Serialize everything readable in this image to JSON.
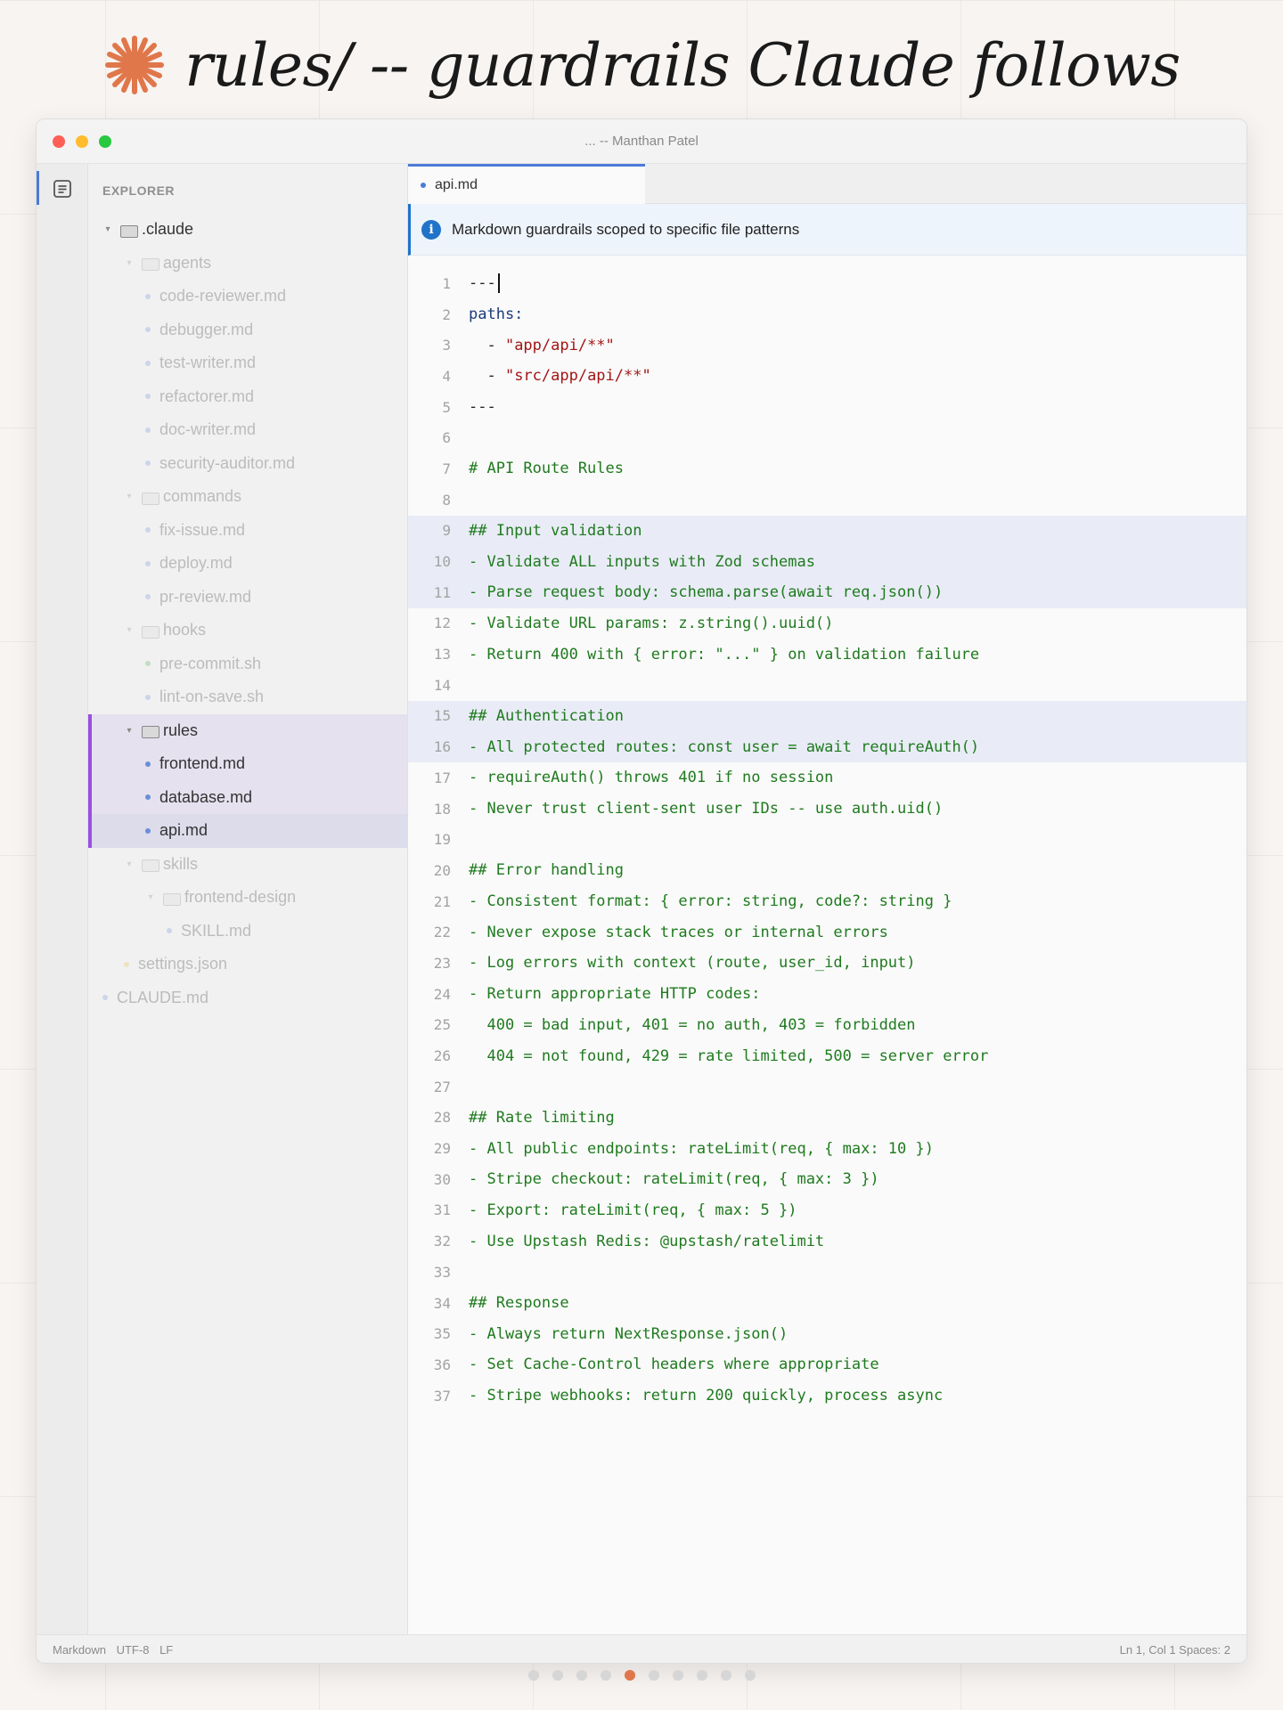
{
  "header": {
    "title": "rules/ -- guardrails Claude follows",
    "logo_icon": "asterisk-burst-icon",
    "logo_color": "#e0774a"
  },
  "window": {
    "title": "... -- Manthan Patel"
  },
  "sidebar": {
    "label": "EXPLORER",
    "tree": [
      {
        "label": ".claude",
        "type": "folder",
        "depth": 0,
        "state": "normal"
      },
      {
        "label": "agents",
        "type": "folder",
        "depth": 1,
        "state": "faded"
      },
      {
        "label": "code-reviewer.md",
        "type": "file",
        "depth": 2,
        "state": "faded"
      },
      {
        "label": "debugger.md",
        "type": "file",
        "depth": 2,
        "state": "faded"
      },
      {
        "label": "test-writer.md",
        "type": "file",
        "depth": 2,
        "state": "faded"
      },
      {
        "label": "refactorer.md",
        "type": "file",
        "depth": 2,
        "state": "faded"
      },
      {
        "label": "doc-writer.md",
        "type": "file",
        "depth": 2,
        "state": "faded"
      },
      {
        "label": "security-auditor.md",
        "type": "file",
        "depth": 2,
        "state": "faded"
      },
      {
        "label": "commands",
        "type": "folder",
        "depth": 1,
        "state": "faded"
      },
      {
        "label": "fix-issue.md",
        "type": "file",
        "depth": 2,
        "state": "faded"
      },
      {
        "label": "deploy.md",
        "type": "file",
        "depth": 2,
        "state": "faded"
      },
      {
        "label": "pr-review.md",
        "type": "file",
        "depth": 2,
        "state": "faded"
      },
      {
        "label": "hooks",
        "type": "folder",
        "depth": 1,
        "state": "faded"
      },
      {
        "label": "pre-commit.sh",
        "type": "file",
        "depth": 2,
        "state": "faded",
        "dot": "#4caf50"
      },
      {
        "label": "lint-on-save.sh",
        "type": "file",
        "depth": 2,
        "state": "faded"
      },
      {
        "label": "rules",
        "type": "folder",
        "depth": 1,
        "state": "rules"
      },
      {
        "label": "frontend.md",
        "type": "file",
        "depth": 2,
        "state": "rules"
      },
      {
        "label": "database.md",
        "type": "file",
        "depth": 2,
        "state": "rules"
      },
      {
        "label": "api.md",
        "type": "file",
        "depth": 2,
        "state": "selected"
      },
      {
        "label": "skills",
        "type": "folder",
        "depth": 1,
        "state": "faded"
      },
      {
        "label": "frontend-design",
        "type": "folder",
        "depth": 2,
        "state": "faded"
      },
      {
        "label": "SKILL.md",
        "type": "file",
        "depth": 3,
        "state": "faded"
      },
      {
        "label": "settings.json",
        "type": "file",
        "depth": 1,
        "state": "faded",
        "dot": "#e6c04a"
      },
      {
        "label": "CLAUDE.md",
        "type": "file",
        "depth": 0,
        "state": "faded"
      }
    ]
  },
  "editor": {
    "tab_label": "api.md",
    "banner_text": "Markdown guardrails scoped to specific file patterns",
    "lines": [
      {
        "n": "1",
        "text": "---",
        "kind": "meta",
        "caret": true
      },
      {
        "n": "2",
        "text": "paths:",
        "kind": "key"
      },
      {
        "n": "3",
        "text": "\"app/api/**\"",
        "kind": "str",
        "prefix": "  - "
      },
      {
        "n": "4",
        "text": "\"src/app/api/**\"",
        "kind": "str",
        "prefix": "  - "
      },
      {
        "n": "5",
        "text": "---",
        "kind": "meta"
      },
      {
        "n": "6",
        "text": ""
      },
      {
        "n": "7",
        "text": "# API Route Rules"
      },
      {
        "n": "8",
        "text": ""
      },
      {
        "n": "9",
        "text": "## Input validation",
        "hl": true
      },
      {
        "n": "10",
        "text": "- Validate ALL inputs with Zod schemas",
        "hl": true
      },
      {
        "n": "11",
        "text": "- Parse request body: schema.parse(await req.json())",
        "hl": true
      },
      {
        "n": "12",
        "text": "- Validate URL params: z.string().uuid()"
      },
      {
        "n": "13",
        "text": "- Return 400 with { error: \"...\" } on validation failure"
      },
      {
        "n": "14",
        "text": ""
      },
      {
        "n": "15",
        "text": "## Authentication",
        "hl": true
      },
      {
        "n": "16",
        "text": "- All protected routes: const user = await requireAuth()",
        "hl": true
      },
      {
        "n": "17",
        "text": "- requireAuth() throws 401 if no session"
      },
      {
        "n": "18",
        "text": "- Never trust client-sent user IDs -- use auth.uid()"
      },
      {
        "n": "19",
        "text": ""
      },
      {
        "n": "20",
        "text": "## Error handling"
      },
      {
        "n": "21",
        "text": "- Consistent format: { error: string, code?: string }"
      },
      {
        "n": "22",
        "text": "- Never expose stack traces or internal errors"
      },
      {
        "n": "23",
        "text": "- Log errors with context (route, user_id, input)"
      },
      {
        "n": "24",
        "text": "- Return appropriate HTTP codes:"
      },
      {
        "n": "25",
        "text": "  400 = bad input, 401 = no auth, 403 = forbidden"
      },
      {
        "n": "26",
        "text": "  404 = not found, 429 = rate limited, 500 = server error"
      },
      {
        "n": "27",
        "text": ""
      },
      {
        "n": "28",
        "text": "## Rate limiting"
      },
      {
        "n": "29",
        "text": "- All public endpoints: rateLimit(req, { max: 10 })"
      },
      {
        "n": "30",
        "text": "- Stripe checkout: rateLimit(req, { max: 3 })"
      },
      {
        "n": "31",
        "text": "- Export: rateLimit(req, { max: 5 })"
      },
      {
        "n": "32",
        "text": "- Use Upstash Redis: @upstash/ratelimit"
      },
      {
        "n": "33",
        "text": ""
      },
      {
        "n": "34",
        "text": "## Response"
      },
      {
        "n": "35",
        "text": "- Always return NextResponse.json()"
      },
      {
        "n": "36",
        "text": "- Set Cache-Control headers where appropriate"
      },
      {
        "n": "37",
        "text": "- Stripe webhooks: return 200 quickly, process async"
      }
    ]
  },
  "statusbar": {
    "language": "Markdown",
    "encoding": "UTF-8",
    "eol": "LF",
    "position": "Ln 1, Col 1",
    "spaces": "Spaces: 2"
  },
  "pager": {
    "total": 10,
    "active": 5
  }
}
